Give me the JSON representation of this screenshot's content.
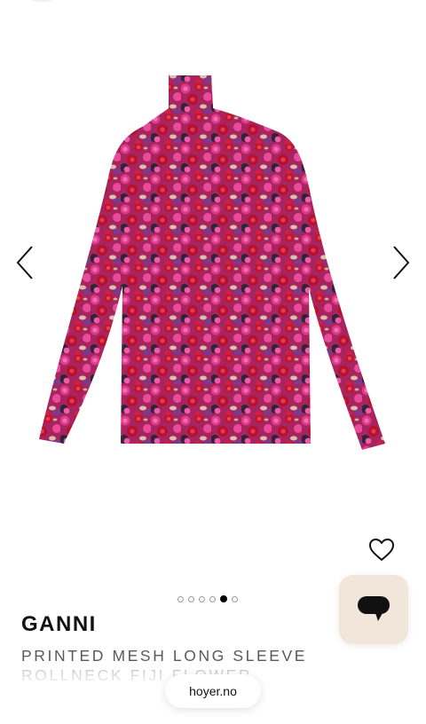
{
  "product": {
    "brand": "GANNI",
    "name": "PRINTED MESH LONG SLEEVE ROLLNECK FIJI FLOWER"
  },
  "gallery": {
    "image_count": 6,
    "active_index": 4,
    "image_description_icon": "floral-rollneck-top"
  },
  "icons": {
    "prev": "chevron-left-icon",
    "next": "chevron-right-icon",
    "wishlist": "heart-outline-icon",
    "chat": "chat-bubble-icon"
  },
  "browser": {
    "domain": "hoyer.no"
  },
  "colors": {
    "chat_button_bg": "#f2e6da",
    "print_base": "#c0236d",
    "print_red": "#c3142f",
    "print_dark": "#2f2438"
  }
}
